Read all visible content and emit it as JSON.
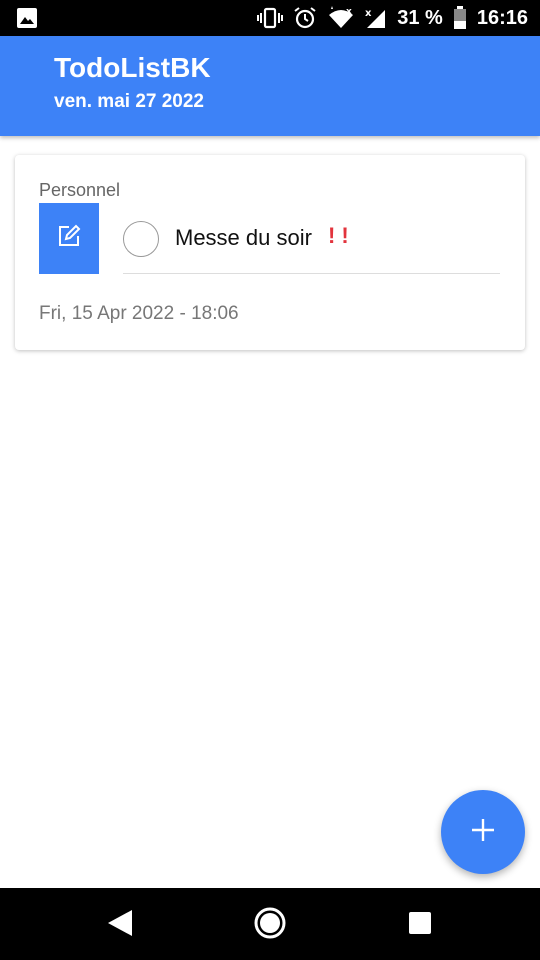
{
  "status_bar": {
    "battery_percent": "31 %",
    "time": "16:16",
    "icons": [
      "image-icon",
      "vibrate-icon",
      "alarm-icon",
      "wifi-icon",
      "signal-icon",
      "battery-icon"
    ]
  },
  "app_bar": {
    "title": "TodoListBK",
    "date": "ven. mai 27 2022",
    "color": "#3d82f7"
  },
  "task_card": {
    "category": "Personnel",
    "title": "Messe du soir",
    "priority": "!!",
    "priority_color": "#e2343d",
    "datetime": "Fri, 15 Apr 2022 - 18:06",
    "edit_icon": "edit-icon",
    "completed": false
  },
  "fab": {
    "icon": "plus-icon"
  },
  "nav_bar": {
    "icons": [
      "back-icon",
      "home-icon",
      "recents-icon"
    ]
  }
}
